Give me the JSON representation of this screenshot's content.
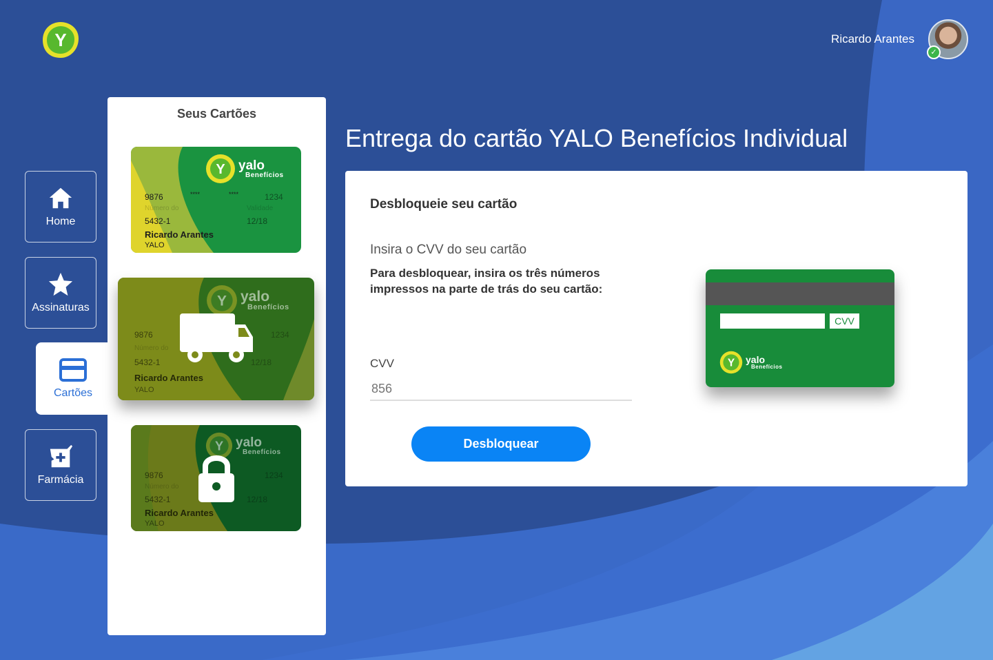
{
  "app": {
    "logo_letter": "Y"
  },
  "user": {
    "name": "Ricardo Arantes"
  },
  "nav": {
    "items": [
      {
        "label": "Home",
        "icon": "home-icon"
      },
      {
        "label": "Assinaturas",
        "icon": "star-icon"
      },
      {
        "label": "Cartões",
        "icon": "credit-card-icon",
        "active": true
      },
      {
        "label": "Farmácia",
        "icon": "pharmacy-icon"
      }
    ]
  },
  "cards_panel": {
    "title": "Seus Cartões",
    "cards": [
      {
        "brand": "yalo",
        "brand_sub": "Benefícios",
        "num_start": "9876",
        "num_mask1": "****",
        "num_mask2": "****",
        "num_end": "1234",
        "faint_label": "Número do",
        "faint_label2": "Validade",
        "code": "5432-1",
        "expiry": "12/18",
        "holder": "Ricardo Arantes",
        "company": "YALO",
        "status": "active"
      },
      {
        "brand": "yalo",
        "brand_sub": "Benefícios",
        "num_start": "9876",
        "num_end": "1234",
        "faint_label": "Número do",
        "code": "5432-1",
        "expiry": "12/18",
        "holder": "Ricardo Arantes",
        "company": "YALO",
        "status": "in-delivery",
        "overlay_icon": "truck-icon"
      },
      {
        "brand": "yalo",
        "brand_sub": "Benefícios",
        "num_start": "9876",
        "num_end": "1234",
        "faint_label": "Número do",
        "code": "5432-1",
        "expiry": "12/18",
        "holder": "Ricardo Arantes",
        "company": "YALO",
        "status": "locked",
        "overlay_icon": "lock-icon"
      }
    ]
  },
  "page": {
    "title": "Entrega do cartão YALO Benefícios Individual"
  },
  "unlock": {
    "section_title": "Desbloqueie seu cartão",
    "subtitle": "Insira o CVV do seu cartão",
    "instructions": "Para desbloquear, insira os três números impressos na parte de trás do seu cartão:",
    "cvv_label": "CVV",
    "cvv_placeholder": "856",
    "button_label": "Desbloquear",
    "card_back": {
      "cvv_tag": "CVV",
      "brand": "yalo",
      "brand_sub": "Benefícios"
    }
  },
  "colors": {
    "background": "#2c4e96",
    "accent_blue": "#0a84f5",
    "card_green": "#188c3a",
    "card_yellow": "#e2d72a"
  }
}
